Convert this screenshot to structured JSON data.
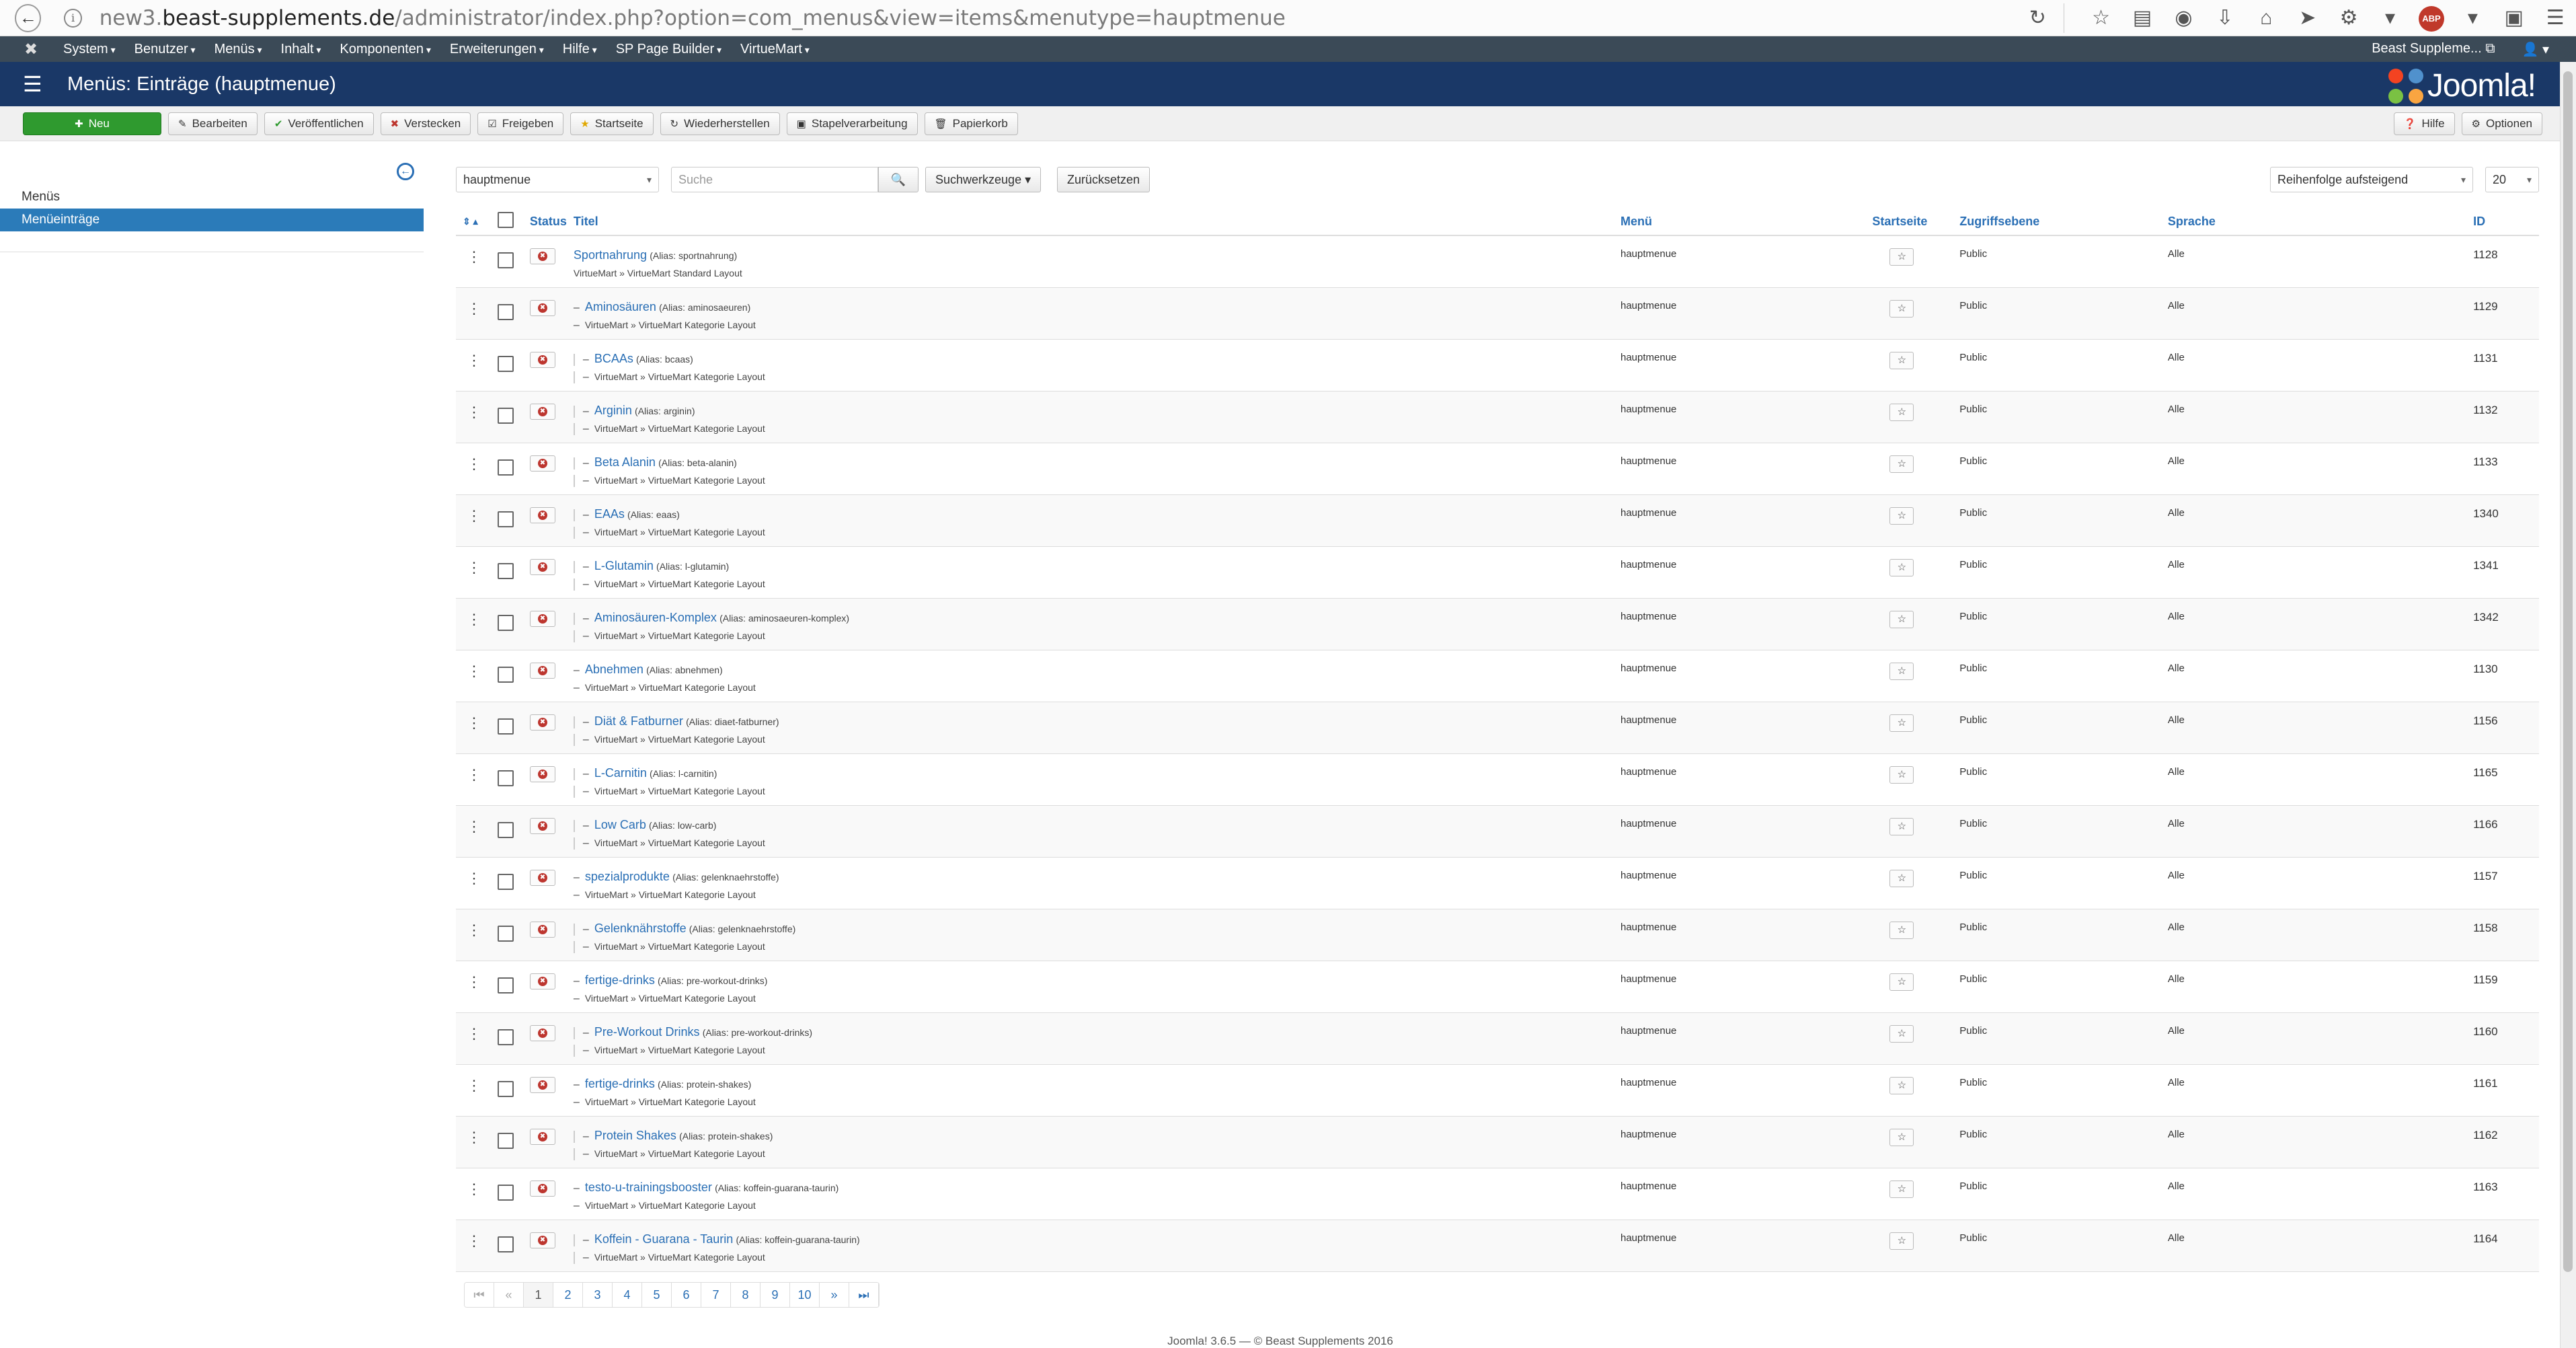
{
  "browser": {
    "url_prefix": "new3.",
    "url_domain": "beast-supplements.de",
    "url_path": "/administrator/index.php?option=com_menus&view=items&menutype=hauptmenue",
    "abp_label": "ABP"
  },
  "topnav": {
    "items": [
      "System",
      "Benutzer",
      "Menüs",
      "Inhalt",
      "Komponenten",
      "Erweiterungen",
      "Hilfe",
      "SP Page Builder",
      "VirtueMart"
    ],
    "site_link": "Beast Suppleme... ⧉",
    "user_menu": "👤"
  },
  "header": {
    "title": "Menüs: Einträge (hauptmenue)",
    "brand": "Joomla!"
  },
  "toolbar": {
    "new": "Neu",
    "edit": "Bearbeiten",
    "publish": "Veröffentlichen",
    "unpublish": "Verstecken",
    "checkin": "Freigeben",
    "home": "Startseite",
    "rebuild": "Wiederherstellen",
    "batch": "Stapelverarbeitung",
    "trash": "Papierkorb",
    "help": "Hilfe",
    "options": "Optionen"
  },
  "sidebar": {
    "items": [
      "Menüs",
      "Menüeinträge"
    ]
  },
  "filters": {
    "menu_select": "hauptmenue",
    "search_placeholder": "Suche",
    "search_tools": "Suchwerkzeuge ▾",
    "reset": "Zurücksetzen",
    "ordering": "Reihenfolge aufsteigend",
    "limit": "20"
  },
  "table": {
    "headers": {
      "sort": "⇕ ▴",
      "status": "Status",
      "title": "Titel",
      "menu": "Menü",
      "home": "Startseite",
      "access": "Zugriffsebene",
      "language": "Sprache",
      "id": "ID"
    },
    "rows": [
      {
        "level": 1,
        "title": "Sportnahrung",
        "alias": "(Alias: sportnahrung)",
        "sub": "VirtueMart » VirtueMart Standard Layout",
        "menu": "hauptmenue",
        "access": "Public",
        "language": "Alle",
        "id": "1128"
      },
      {
        "level": 2,
        "title": "Aminosäuren",
        "alias": "(Alias: aminosaeuren)",
        "sub": "VirtueMart » VirtueMart Kategorie Layout",
        "menu": "hauptmenue",
        "access": "Public",
        "language": "Alle",
        "id": "1129"
      },
      {
        "level": 3,
        "title": "BCAAs",
        "alias": "(Alias: bcaas)",
        "sub": "VirtueMart » VirtueMart Kategorie Layout",
        "menu": "hauptmenue",
        "access": "Public",
        "language": "Alle",
        "id": "1131"
      },
      {
        "level": 3,
        "title": "Arginin",
        "alias": "(Alias: arginin)",
        "sub": "VirtueMart » VirtueMart Kategorie Layout",
        "menu": "hauptmenue",
        "access": "Public",
        "language": "Alle",
        "id": "1132"
      },
      {
        "level": 3,
        "title": "Beta Alanin",
        "alias": "(Alias: beta-alanin)",
        "sub": "VirtueMart » VirtueMart Kategorie Layout",
        "menu": "hauptmenue",
        "access": "Public",
        "language": "Alle",
        "id": "1133"
      },
      {
        "level": 3,
        "title": "EAAs",
        "alias": "(Alias: eaas)",
        "sub": "VirtueMart » VirtueMart Kategorie Layout",
        "menu": "hauptmenue",
        "access": "Public",
        "language": "Alle",
        "id": "1340"
      },
      {
        "level": 3,
        "title": "L-Glutamin",
        "alias": "(Alias: l-glutamin)",
        "sub": "VirtueMart » VirtueMart Kategorie Layout",
        "menu": "hauptmenue",
        "access": "Public",
        "language": "Alle",
        "id": "1341"
      },
      {
        "level": 3,
        "title": "Aminosäuren-Komplex",
        "alias": "(Alias: aminosaeuren-komplex)",
        "sub": "VirtueMart » VirtueMart Kategorie Layout",
        "menu": "hauptmenue",
        "access": "Public",
        "language": "Alle",
        "id": "1342"
      },
      {
        "level": 2,
        "title": "Abnehmen",
        "alias": "(Alias: abnehmen)",
        "sub": "VirtueMart » VirtueMart Kategorie Layout",
        "menu": "hauptmenue",
        "access": "Public",
        "language": "Alle",
        "id": "1130"
      },
      {
        "level": 3,
        "title": "Diät & Fatburner",
        "alias": "(Alias: diaet-fatburner)",
        "sub": "VirtueMart » VirtueMart Kategorie Layout",
        "menu": "hauptmenue",
        "access": "Public",
        "language": "Alle",
        "id": "1156"
      },
      {
        "level": 3,
        "title": "L-Carnitin",
        "alias": "(Alias: l-carnitin)",
        "sub": "VirtueMart » VirtueMart Kategorie Layout",
        "menu": "hauptmenue",
        "access": "Public",
        "language": "Alle",
        "id": "1165"
      },
      {
        "level": 3,
        "title": "Low Carb",
        "alias": "(Alias: low-carb)",
        "sub": "VirtueMart » VirtueMart Kategorie Layout",
        "menu": "hauptmenue",
        "access": "Public",
        "language": "Alle",
        "id": "1166"
      },
      {
        "level": 2,
        "title": "spezialprodukte",
        "alias": "(Alias: gelenknaehrstoffe)",
        "sub": "VirtueMart » VirtueMart Kategorie Layout",
        "menu": "hauptmenue",
        "access": "Public",
        "language": "Alle",
        "id": "1157"
      },
      {
        "level": 3,
        "title": "Gelenknährstoffe",
        "alias": "(Alias: gelenknaehrstoffe)",
        "sub": "VirtueMart » VirtueMart Kategorie Layout",
        "menu": "hauptmenue",
        "access": "Public",
        "language": "Alle",
        "id": "1158"
      },
      {
        "level": 2,
        "title": "fertige-drinks",
        "alias": "(Alias: pre-workout-drinks)",
        "sub": "VirtueMart » VirtueMart Kategorie Layout",
        "menu": "hauptmenue",
        "access": "Public",
        "language": "Alle",
        "id": "1159"
      },
      {
        "level": 3,
        "title": "Pre-Workout Drinks",
        "alias": "(Alias: pre-workout-drinks)",
        "sub": "VirtueMart » VirtueMart Kategorie Layout",
        "menu": "hauptmenue",
        "access": "Public",
        "language": "Alle",
        "id": "1160"
      },
      {
        "level": 2,
        "title": "fertige-drinks",
        "alias": "(Alias: protein-shakes)",
        "sub": "VirtueMart » VirtueMart Kategorie Layout",
        "menu": "hauptmenue",
        "access": "Public",
        "language": "Alle",
        "id": "1161"
      },
      {
        "level": 3,
        "title": "Protein Shakes",
        "alias": "(Alias: protein-shakes)",
        "sub": "VirtueMart » VirtueMart Kategorie Layout",
        "menu": "hauptmenue",
        "access": "Public",
        "language": "Alle",
        "id": "1162"
      },
      {
        "level": 2,
        "title": "testo-u-trainingsbooster",
        "alias": "(Alias: koffein-guarana-taurin)",
        "sub": "VirtueMart » VirtueMart Kategorie Layout",
        "menu": "hauptmenue",
        "access": "Public",
        "language": "Alle",
        "id": "1163"
      },
      {
        "level": 3,
        "title": "Koffein - Guarana - Taurin",
        "alias": "(Alias: koffein-guarana-taurin)",
        "sub": "VirtueMart » VirtueMart Kategorie Layout",
        "menu": "hauptmenue",
        "access": "Public",
        "language": "Alle",
        "id": "1164"
      }
    ]
  },
  "pagination": {
    "first": "⏮",
    "prev": "«",
    "pages": [
      "1",
      "2",
      "3",
      "4",
      "5",
      "6",
      "7",
      "8",
      "9",
      "10"
    ],
    "next": "»",
    "last": "⏭",
    "current": "1"
  },
  "footer": "Joomla! 3.6.5  —  © Beast Supplements 2016"
}
